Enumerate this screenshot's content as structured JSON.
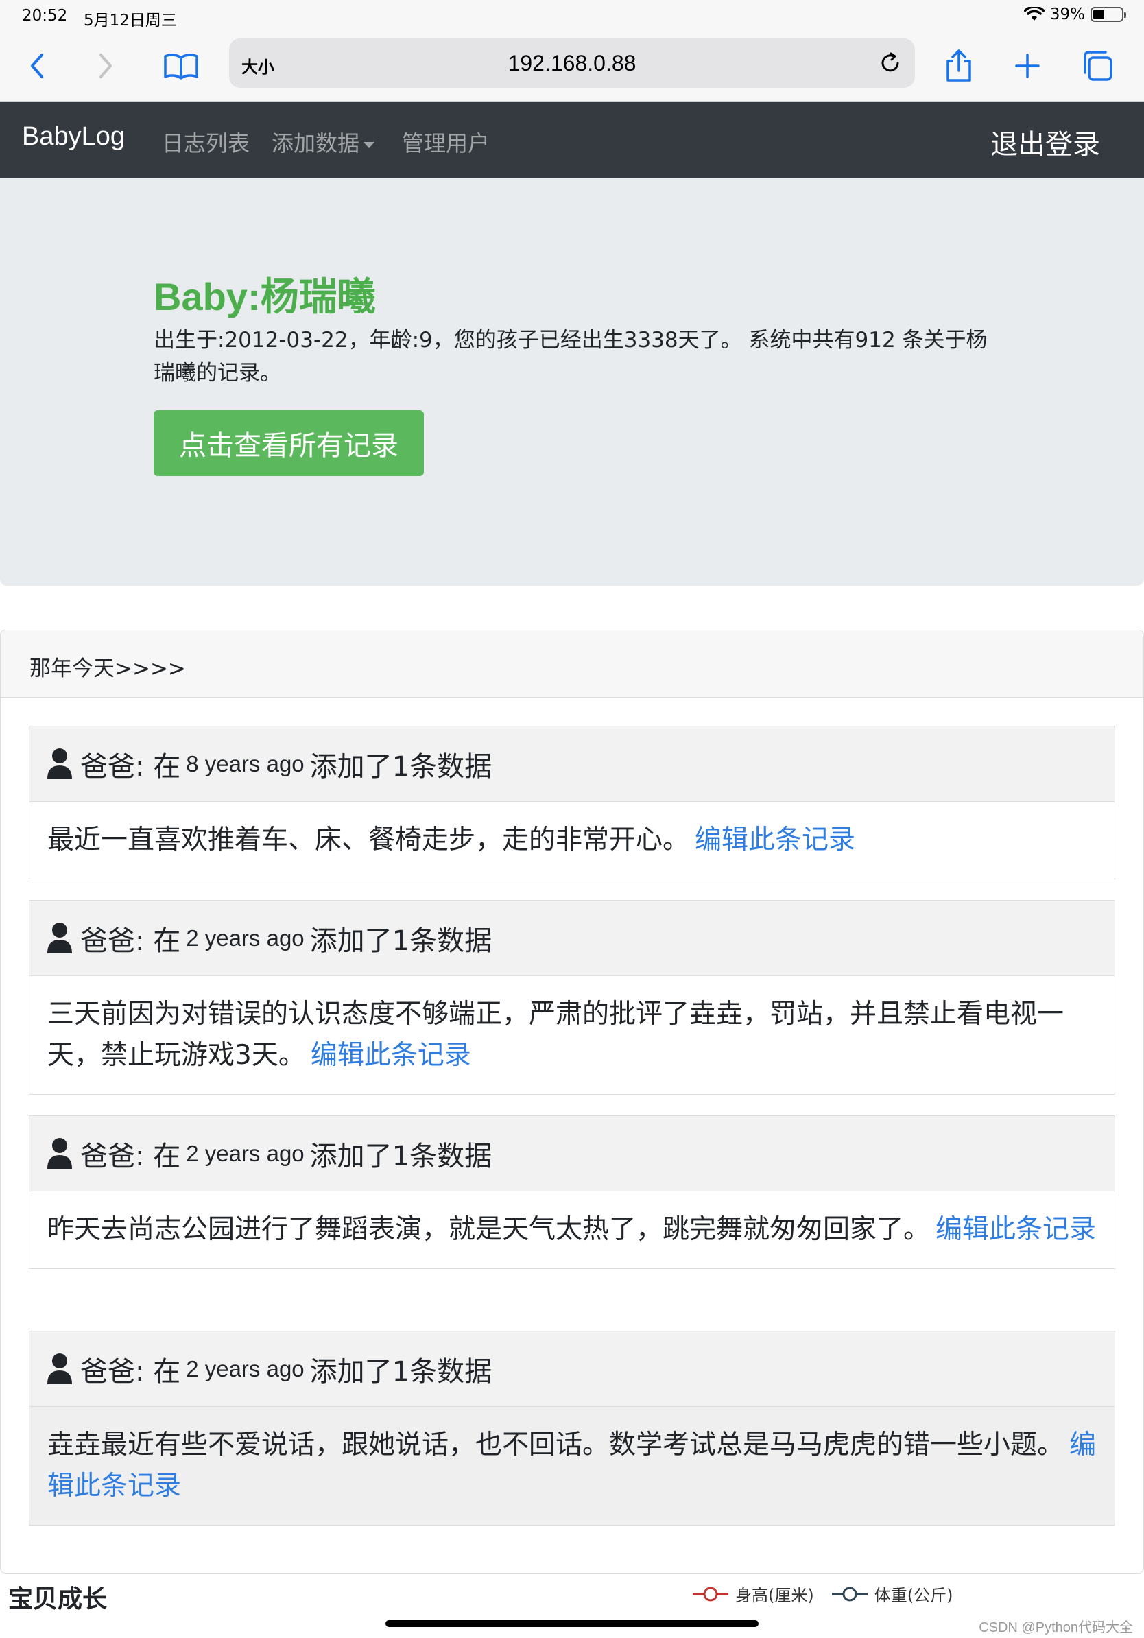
{
  "status_bar": {
    "time": "20:52",
    "date": "5月12日周三",
    "battery": "39%",
    "battery_level": 0.39
  },
  "browser": {
    "text_size_label": "大小",
    "url": "192.168.0.88"
  },
  "navbar": {
    "brand": "BabyLog",
    "links": [
      "日志列表",
      "添加数据",
      "管理用户"
    ],
    "logout": "退出登录"
  },
  "jumbotron": {
    "title": "Baby:杨瑞曦",
    "text": "出生于:2012-03-22，年龄:9，您的孩子已经出生3338天了。 系统中共有912 条关于杨瑞曦的记录。",
    "button": "点击查看所有记录"
  },
  "card": {
    "header": "那年今天>>>>",
    "entries": [
      {
        "author": "爸爸: 在",
        "ago": "8 years ago",
        "action": "添加了1条数据",
        "content": "最近一直喜欢推着车、床、餐椅走步，走的非常开心。",
        "edit": "编辑此条记录"
      },
      {
        "author": "爸爸: 在",
        "ago": "2 years ago",
        "action": "添加了1条数据",
        "content": "三天前因为对错误的认识态度不够端正，严肃的批评了垚垚，罚站，并且禁止看电视一天，禁止玩游戏3天。",
        "edit": "编辑此条记录"
      },
      {
        "author": "爸爸: 在",
        "ago": "2 years ago",
        "action": "添加了1条数据",
        "content": "昨天去尚志公园进行了舞蹈表演，就是天气太热了，跳完舞就匆匆回家了。",
        "edit": "编辑此条记录"
      },
      {
        "author": "爸爸: 在",
        "ago": "2 years ago",
        "action": "添加了1条数据",
        "content": "垚垚最近有些不爱说话，跟她说话，也不回话。数学考试总是马马虎虎的错一些小题。",
        "edit": "编辑此条记录"
      }
    ]
  },
  "growth": {
    "title": "宝贝成长",
    "legend": [
      {
        "label": "身高(厘米)",
        "color": "#c23531"
      },
      {
        "label": "体重(公斤)",
        "color": "#2f4554"
      }
    ]
  },
  "watermark": "CSDN @Python代码大全"
}
